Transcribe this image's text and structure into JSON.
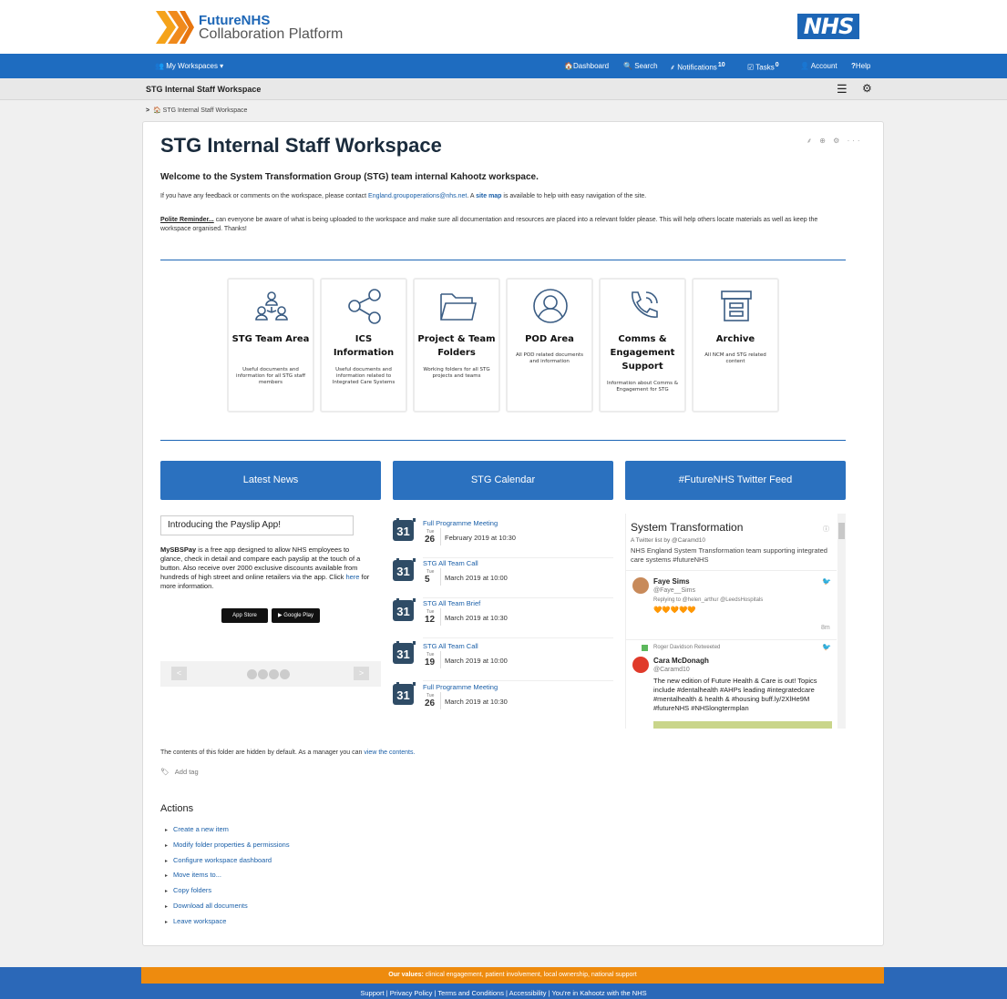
{
  "brand": {
    "line1": "FutureNHS",
    "line2": "Collaboration Platform",
    "nhs": "NHS"
  },
  "nav": {
    "workspaces": "My Workspaces ▾",
    "dashboard": "Dashboard",
    "search": "Search",
    "notifications": "Notifications",
    "notifications_count": "10",
    "tasks": "Tasks",
    "tasks_count": "0",
    "account": "Account",
    "help": "Help"
  },
  "workspace_bar": {
    "title": "STG Internal Staff Workspace"
  },
  "breadcrumb": {
    "label": "STG Internal Staff Workspace"
  },
  "page": {
    "title": "STG Internal Staff Workspace",
    "welcome": "Welcome to the System Transformation Group (STG) team internal Kahootz workspace.",
    "feedback_pre": "If you have any feedback or comments on the workspace, please contact ",
    "feedback_email": "England.groupoperations@nhs.net",
    "feedback_mid": ". A ",
    "feedback_sitemap": "site map",
    "feedback_post": " is available to help with easy navigation of the site.",
    "reminder_lead": "Polite Reminder...",
    "reminder_text": " can everyone be aware of what is being uploaded to the workspace and make sure all documentation and resources are placed into a relevant folder please. This will help others locate materials as well as keep the workspace organised. Thanks!"
  },
  "tiles": [
    {
      "title": "STG Team Area",
      "desc": "Useful documents and information for all STG staff members"
    },
    {
      "title": "ICS Information",
      "desc": "Useful documents and information related to Integrated Care Systems"
    },
    {
      "title": "Project & Team Folders",
      "desc": "Working folders for all STG projects and teams"
    },
    {
      "title": "POD Area",
      "desc": "All POD related documents and information"
    },
    {
      "title": "Comms & Engagement Support",
      "desc": "Information about Comms & Engagement for STG"
    },
    {
      "title": "Archive",
      "desc": "All NCM and STG related content"
    }
  ],
  "columns": {
    "news": "Latest News",
    "calendar": "STG Calendar",
    "twitter": "#FutureNHS Twitter Feed"
  },
  "news": {
    "headline": "Introducing the Payslip App!",
    "app_name": "MySBSPay",
    "body": " is a free app designed to allow NHS employees to glance, check in detail and compare each payslip at the touch of a button. Also receive over 2000 exclusive discounts available from hundreds of high street and online retailers via the app. Click ",
    "link": "here",
    "body_end": " for more information.",
    "app_store": "App Store",
    "google_play": "Google Play",
    "prev": "<",
    "next": ">"
  },
  "calendar": [
    {
      "title": "Full Programme Meeting",
      "icon_day": "31",
      "dow": "Tue",
      "day": "26",
      "when": "February 2019 at 10:30"
    },
    {
      "title": "STG All Team Call",
      "icon_day": "31",
      "dow": "Tue",
      "day": "5",
      "when": "March 2019 at 10:00"
    },
    {
      "title": "STG All Team Brief",
      "icon_day": "31",
      "dow": "Tue",
      "day": "12",
      "when": "March 2019 at 10:30"
    },
    {
      "title": "STG All Team Call",
      "icon_day": "31",
      "dow": "Tue",
      "day": "19",
      "when": "March 2019 at 10:00"
    },
    {
      "title": "Full Programme Meeting",
      "icon_day": "31",
      "dow": "Tue",
      "day": "26",
      "when": "March 2019 at 10:30"
    }
  ],
  "twitter": {
    "list_title": "System Transformation",
    "list_by": "A Twitter list by @Caramd10",
    "list_desc": "NHS England System Transformation team supporting integrated care systems #futureNHS",
    "t1_name": "Faye Sims",
    "t1_handle": "@Faye__Sims",
    "t1_reply": "Replying to @helen_arthur @LeedsHospitals",
    "t1_hearts": "🧡🧡🧡🧡🧡",
    "t1_time": "8m",
    "rt_by": "Roger Davidson Retweeted",
    "t2_name": "Cara McDonagh",
    "t2_handle": "@Caramd10",
    "t2_text": "The new edition of Future Health & Care is out! Topics include #dentalhealth #AHPs leading #integratedcare #mentalhealth & health & #housing  buff.ly/2XlHe9M #futureNHS #NHSlongtermplan"
  },
  "folder_note": {
    "text": "The contents of this folder are hidden by default. As a manager you can ",
    "link": "view the contents."
  },
  "tag": "Add tag",
  "actions": {
    "heading": "Actions",
    "items": [
      "Create a new item",
      "Modify folder properties & permissions",
      "Configure workspace dashboard",
      "Move items to...",
      "Copy folders",
      "Download all documents",
      "Leave workspace"
    ]
  },
  "footer": {
    "values_lead": "Our values:",
    "values_text": " clinical engagement, patient involvement, local ownership, national support",
    "links": "Support  |  Privacy Policy  |  Terms and Conditions  |  Accessibility  |  You're in Kahootz with the NHS"
  },
  "colors": {
    "nhs_blue": "#1e6cc0",
    "accent_orange": "#ee8b0e",
    "heading_blue": "#2b71bf"
  }
}
